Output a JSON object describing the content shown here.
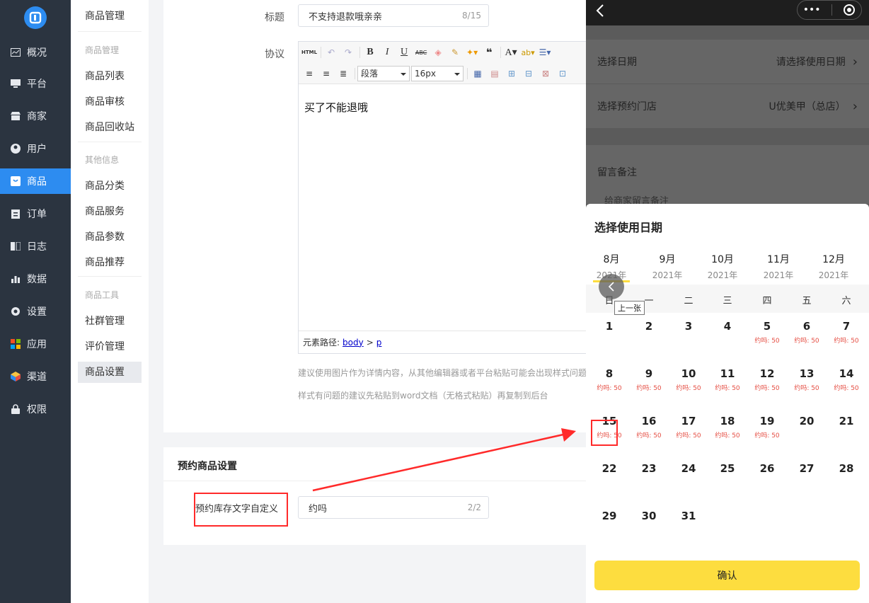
{
  "nav": {
    "items": [
      {
        "label": "概况",
        "icon": "chart-icon"
      },
      {
        "label": "平台",
        "icon": "monitor-icon"
      },
      {
        "label": "商家",
        "icon": "store-icon"
      },
      {
        "label": "用户",
        "icon": "user-icon"
      },
      {
        "label": "商品",
        "icon": "bag-icon"
      },
      {
        "label": "订单",
        "icon": "order-icon"
      },
      {
        "label": "日志",
        "icon": "book-icon"
      },
      {
        "label": "数据",
        "icon": "bar-chart-icon"
      },
      {
        "label": "设置",
        "icon": "gear-icon"
      },
      {
        "label": "应用",
        "icon": "apps-icon"
      },
      {
        "label": "渠道",
        "icon": "cube-icon"
      },
      {
        "label": "权限",
        "icon": "lock-icon"
      }
    ]
  },
  "subnav": {
    "title": "商品管理",
    "group1": "商品管理",
    "items1": [
      "商品列表",
      "商品审核",
      "商品回收站"
    ],
    "group2": "其他信息",
    "items2": [
      "商品分类",
      "商品服务",
      "商品参数",
      "商品推荐"
    ],
    "group3": "商品工具",
    "items3": [
      "社群管理",
      "评价管理",
      "商品设置"
    ]
  },
  "form": {
    "title_label": "标题",
    "title_value": "不支持退款哦亲亲",
    "title_count": "8/15",
    "agreement_label": "协议",
    "editor_content": "买了不能退哦",
    "editor_path_label": "元素路径:",
    "editor_path_body": "body",
    "editor_path_sep": ">",
    "editor_path_p": "p",
    "toolbar": {
      "html": "HTML",
      "bold": "B",
      "italic": "I",
      "underline": "U",
      "strike": "ABC",
      "paragraph": "段落",
      "font_size": "16px"
    },
    "hint1": "建议使用图片作为详情内容，从其他编辑器或者平台粘贴可能会出现样式问题",
    "hint2": "样式有问题的建议先粘贴到word文档（无格式粘贴）再复制到后台"
  },
  "reserve": {
    "section_title": "预约商品设置",
    "label": "预约库存文字自定义",
    "value": "约吗",
    "count": "2/2"
  },
  "phone": {
    "rows": [
      {
        "label": "选择日期",
        "value": "请选择使用日期"
      },
      {
        "label": "选择预约门店",
        "value": "U优美甲（总店）"
      }
    ],
    "remark_label": "留言备注",
    "remark_placeholder": "给商家留言备注",
    "sheet_title": "选择使用日期",
    "months": [
      {
        "m": "8月",
        "y": "2021年"
      },
      {
        "m": "9月",
        "y": "2021年"
      },
      {
        "m": "10月",
        "y": "2021年"
      },
      {
        "m": "11月",
        "y": "2021年"
      },
      {
        "m": "12月",
        "y": "2021年"
      }
    ],
    "prev_tooltip": "上一张",
    "weekdays": [
      "日",
      "一",
      "二",
      "三",
      "四",
      "五",
      "六"
    ],
    "days": [
      {
        "n": "1",
        "s": ""
      },
      {
        "n": "2",
        "s": ""
      },
      {
        "n": "3",
        "s": ""
      },
      {
        "n": "4",
        "s": ""
      },
      {
        "n": "5",
        "s": "约吗: 50"
      },
      {
        "n": "6",
        "s": "约吗: 50"
      },
      {
        "n": "7",
        "s": "约吗: 50"
      },
      {
        "n": "8",
        "s": "约吗: 50"
      },
      {
        "n": "9",
        "s": "约吗: 50"
      },
      {
        "n": "10",
        "s": "约吗: 50"
      },
      {
        "n": "11",
        "s": "约吗: 50"
      },
      {
        "n": "12",
        "s": "约吗: 50"
      },
      {
        "n": "13",
        "s": "约吗: 50"
      },
      {
        "n": "14",
        "s": "约吗: 50"
      },
      {
        "n": "15",
        "s": "约吗: 50"
      },
      {
        "n": "16",
        "s": "约吗: 50"
      },
      {
        "n": "17",
        "s": "约吗: 50"
      },
      {
        "n": "18",
        "s": "约吗: 50"
      },
      {
        "n": "19",
        "s": "约吗: 50"
      },
      {
        "n": "20",
        "s": ""
      },
      {
        "n": "21",
        "s": ""
      },
      {
        "n": "22",
        "s": ""
      },
      {
        "n": "23",
        "s": ""
      },
      {
        "n": "24",
        "s": ""
      },
      {
        "n": "25",
        "s": ""
      },
      {
        "n": "26",
        "s": ""
      },
      {
        "n": "27",
        "s": ""
      },
      {
        "n": "28",
        "s": ""
      },
      {
        "n": "29",
        "s": ""
      },
      {
        "n": "30",
        "s": ""
      },
      {
        "n": "31",
        "s": ""
      }
    ],
    "confirm": "确认"
  },
  "colors": {
    "primary": "#2d8cf0",
    "nav_bg": "#2b3440",
    "accent_yellow": "#fddd3f",
    "annotation_red": "#ff2a2a",
    "stock_red": "#e54d42"
  }
}
